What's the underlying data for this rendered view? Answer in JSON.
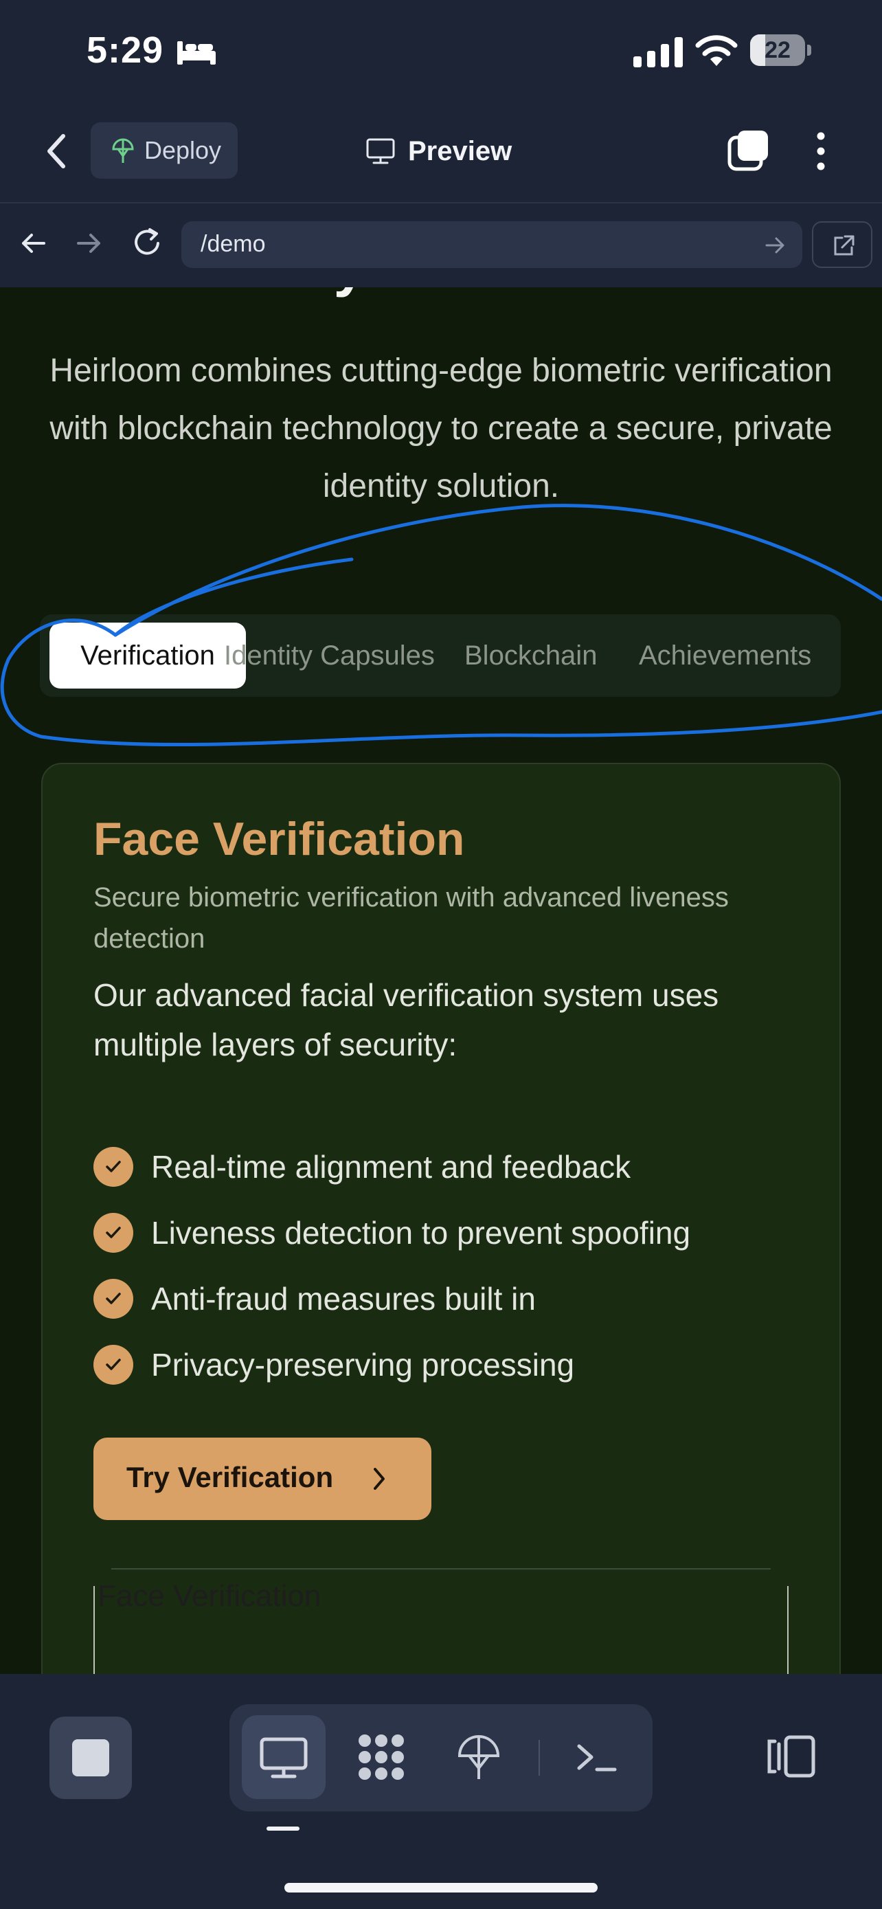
{
  "status_bar": {
    "time": "5:29",
    "battery": "22"
  },
  "header": {
    "deploy_label": "Deploy",
    "title": "Preview"
  },
  "browser": {
    "url": "/demo"
  },
  "page": {
    "heading": "Key Features",
    "intro": "Heirloom combines cutting-edge biometric verification with blockchain technology to create a secure, private identity solution.",
    "tabs": [
      {
        "label": "Verification",
        "active": true
      },
      {
        "label": "Identity Capsules",
        "active": false
      },
      {
        "label": "Blockchain",
        "active": false
      },
      {
        "label": "Achievements",
        "active": false
      }
    ],
    "card": {
      "title": "Face Verification",
      "subtitle": "Secure biometric verification with advanced liveness detection",
      "description": "Our advanced facial verification system uses multiple layers of security:",
      "features": [
        "Real-time alignment and feedback",
        "Liveness detection to prevent spoofing",
        "Anti-fraud measures built in",
        "Privacy-preserving processing"
      ],
      "button_label": "Try Verification",
      "demo_label": "Face Verification"
    }
  },
  "dock": {
    "items": [
      "desktop-icon",
      "apps-icon",
      "deploy-icon",
      "terminal-icon"
    ],
    "active": "desktop-icon"
  },
  "colors": {
    "accent": "#d9a165",
    "annotation": "#1a6fe0",
    "chrome": "#1d2436",
    "page_bg": "#0f1a0b"
  }
}
